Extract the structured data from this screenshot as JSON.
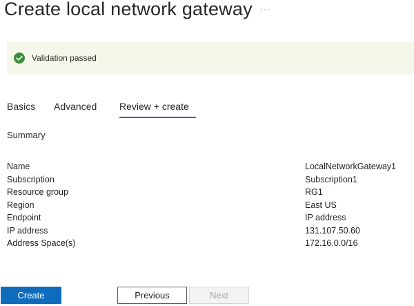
{
  "page": {
    "title": "Create local network gateway",
    "more_label": "···"
  },
  "validation": {
    "message": "Validation passed",
    "icon": "check-circle-icon",
    "color": "#3a8f3a"
  },
  "tabs": [
    {
      "label": "Basics",
      "active": false
    },
    {
      "label": "Advanced",
      "active": false
    },
    {
      "label": "Review + create",
      "active": true
    }
  ],
  "summary": {
    "heading": "Summary",
    "rows": [
      {
        "key": "Name",
        "value": "LocalNetworkGateway1"
      },
      {
        "key": "Subscription",
        "value": "Subscription1"
      },
      {
        "key": "Resource group",
        "value": "RG1"
      },
      {
        "key": "Region",
        "value": "East US"
      },
      {
        "key": "Endpoint",
        "value": "IP address"
      },
      {
        "key": "IP address",
        "value": "131.107.50.60"
      },
      {
        "key": "Address Space(s)",
        "value": "172.16.0.0/16"
      }
    ]
  },
  "buttons": {
    "create": "Create",
    "previous": "Previous",
    "next": "Next"
  },
  "colors": {
    "accent": "#0f6cbd",
    "banner_bg": "#f5f7ea"
  }
}
